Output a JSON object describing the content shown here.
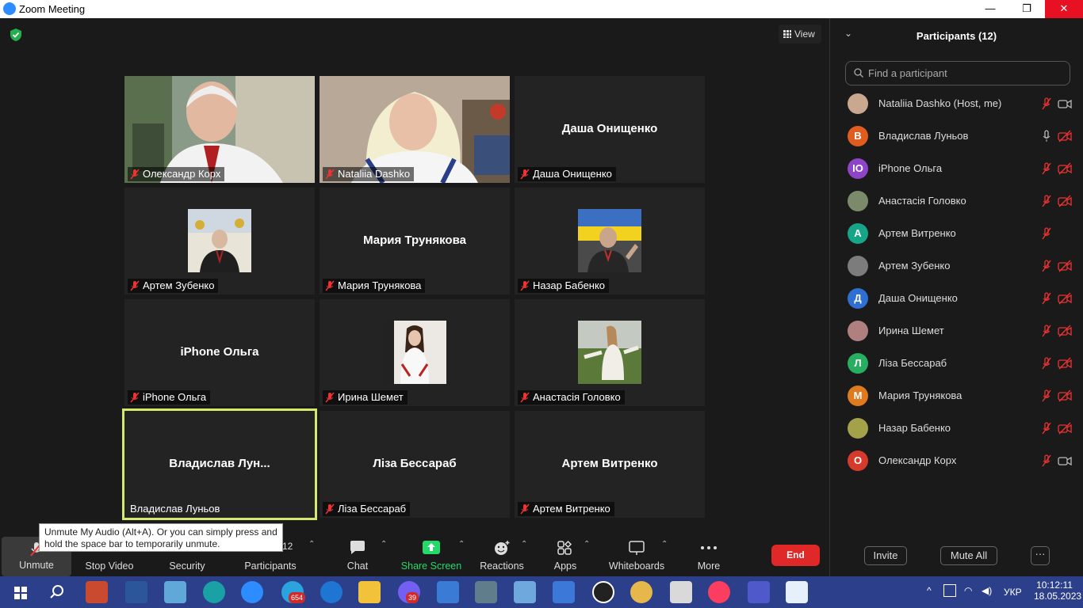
{
  "window": {
    "title": "Zoom Meeting",
    "minimize": "—",
    "restore": "❐",
    "close": "✕"
  },
  "view_button": "View",
  "tiles": [
    {
      "name": "Олександр Корх",
      "big": "",
      "kind": "video",
      "muted": true
    },
    {
      "name": "Nataliia Dashko",
      "big": "",
      "kind": "video",
      "muted": true
    },
    {
      "name": "Даша Онищенко",
      "big": "Даша Онищенко",
      "kind": "name",
      "muted": true
    },
    {
      "name": "Артем Зубенко",
      "big": "",
      "kind": "photo",
      "muted": true
    },
    {
      "name": "Мария Трунякова",
      "big": "Мария Трунякова",
      "kind": "name",
      "muted": true
    },
    {
      "name": "Назар Бабенко",
      "big": "",
      "kind": "photo",
      "muted": true
    },
    {
      "name": "iPhone Ольга",
      "big": "iPhone Ольга",
      "kind": "name",
      "muted": true
    },
    {
      "name": "Ирина Шемет",
      "big": "",
      "kind": "photo",
      "muted": true
    },
    {
      "name": "Анастасія Головко",
      "big": "",
      "kind": "photo",
      "muted": true
    },
    {
      "name": "Владислав Луньов",
      "big": "Владислав  Лун...",
      "kind": "name",
      "muted": false
    },
    {
      "name": "Ліза Бессараб",
      "big": "Ліза Бессараб",
      "kind": "name",
      "muted": true
    },
    {
      "name": "Артем Витренко",
      "big": "Артем Витренко",
      "kind": "name",
      "muted": true
    }
  ],
  "tooltip": "Unmute My Audio (Alt+A). Or you can simply press and hold the space bar to temporarily unmute.",
  "toolbar": {
    "unmute": "Unmute",
    "stop_video": "Stop Video",
    "security": "Security",
    "participants": "Participants",
    "participants_count": "12",
    "chat": "Chat",
    "share_screen": "Share Screen",
    "reactions": "Reactions",
    "apps": "Apps",
    "whiteboards": "Whiteboards",
    "more": "More",
    "end": "End"
  },
  "panel": {
    "title": "Participants (12)",
    "search_placeholder": "Find a participant",
    "invite": "Invite",
    "mute_all": "Mute All",
    "more": "···",
    "participants": [
      {
        "name": "Nataliia Dashko (Host, me)",
        "initial": "",
        "color": "#c9a88f",
        "mic": "muted",
        "cam": "on"
      },
      {
        "name": "Владислав Луньов",
        "initial": "В",
        "color": "#e05d1f",
        "mic": "on",
        "cam": "off"
      },
      {
        "name": "iPhone Ольга",
        "initial": "IO",
        "color": "#8e44c7",
        "mic": "muted",
        "cam": "off"
      },
      {
        "name": "Анастасія Головко",
        "initial": "",
        "color": "#7a8a6a",
        "mic": "muted",
        "cam": "off"
      },
      {
        "name": "Артем Витренко",
        "initial": "A",
        "color": "#17a589",
        "mic": "muted",
        "cam": "none"
      },
      {
        "name": "Артем Зубенко",
        "initial": "",
        "color": "#7c7c7c",
        "mic": "muted",
        "cam": "off"
      },
      {
        "name": "Даша Онищенко",
        "initial": "Д",
        "color": "#2e6fd1",
        "mic": "muted",
        "cam": "off"
      },
      {
        "name": "Ирина Шемет",
        "initial": "",
        "color": "#b08080",
        "mic": "muted",
        "cam": "off"
      },
      {
        "name": "Ліза Бессараб",
        "initial": "Л",
        "color": "#27ae60",
        "mic": "muted",
        "cam": "off"
      },
      {
        "name": "Мария Трунякова",
        "initial": "M",
        "color": "#e07a1f",
        "mic": "muted",
        "cam": "off"
      },
      {
        "name": "Назар Бабенко",
        "initial": "",
        "color": "#a3a24a",
        "mic": "muted",
        "cam": "off"
      },
      {
        "name": "Олександр Корх",
        "initial": "O",
        "color": "#d63a2a",
        "mic": "muted",
        "cam": "on"
      }
    ]
  },
  "taskbar": {
    "badge_1": "654",
    "badge_2": "39",
    "lang": "УКР",
    "time": "10:12:11",
    "date": "18.05.2023"
  }
}
